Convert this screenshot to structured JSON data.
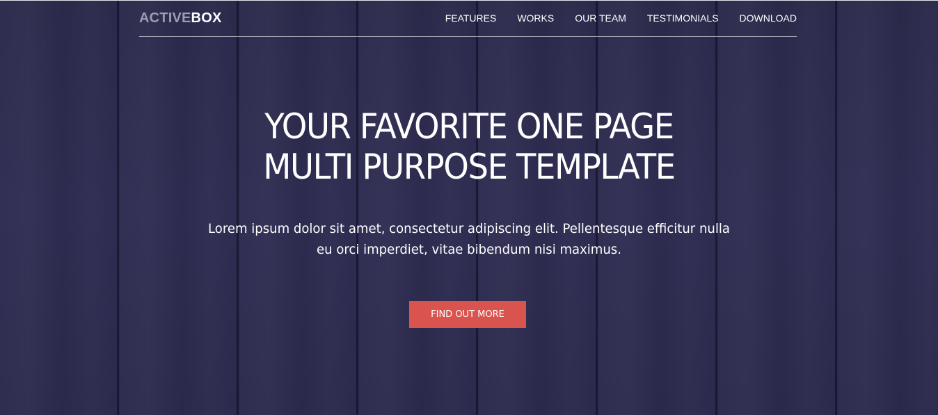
{
  "brand": {
    "part1": "ACTIVE",
    "part2": "BOX"
  },
  "nav": {
    "items": [
      {
        "label": "FEATURES"
      },
      {
        "label": "WORKS"
      },
      {
        "label": "OUR TEAM"
      },
      {
        "label": "TESTIMONIALS"
      },
      {
        "label": "DOWNLOAD"
      }
    ]
  },
  "hero": {
    "headline_line1": "YOUR FAVORITE ONE PAGE",
    "headline_line2": "MULTI PURPOSE TEMPLATE",
    "subtext_line1": "Lorem ipsum dolor sit amet, consectetur adipiscing elit. Pellentesque efficitur nulla",
    "subtext_line2": "eu orci imperdiet, vitae bibendum nisi maximus.",
    "cta_label": "FIND OUT MORE"
  },
  "colors": {
    "background": "#2c2b50",
    "accent": "#d9534f",
    "logo_muted": "#9d9cb2",
    "text": "#ffffff"
  }
}
